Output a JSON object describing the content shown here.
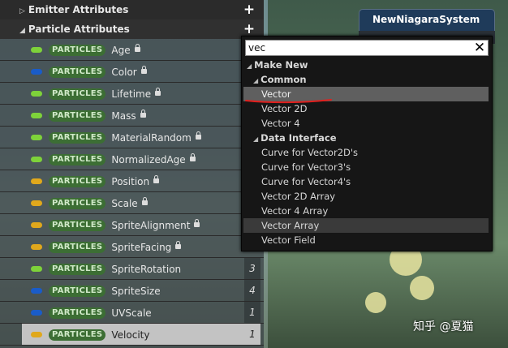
{
  "sections": {
    "emitter": {
      "label": "Emitter Attributes"
    },
    "particle": {
      "label": "Particle Attributes"
    }
  },
  "pill_label": "PARTICLES",
  "attributes": [
    {
      "name": "Age",
      "color": "#7ed23a",
      "count": ""
    },
    {
      "name": "Color",
      "color": "#1a5cc8",
      "count": ""
    },
    {
      "name": "Lifetime",
      "color": "#7ed23a",
      "count": ""
    },
    {
      "name": "Mass",
      "color": "#7ed23a",
      "count": ""
    },
    {
      "name": "MaterialRandom",
      "color": "#7ed23a",
      "count": ""
    },
    {
      "name": "NormalizedAge",
      "color": "#7ed23a",
      "count": ""
    },
    {
      "name": "Position",
      "color": "#e0a81c",
      "count": ""
    },
    {
      "name": "Scale",
      "color": "#e0a81c",
      "count": ""
    },
    {
      "name": "SpriteAlignment",
      "color": "#e0a81c",
      "count": ""
    },
    {
      "name": "SpriteFacing",
      "color": "#e0a81c",
      "count": ""
    },
    {
      "name": "SpriteRotation",
      "color": "#7ed23a",
      "count": "3"
    },
    {
      "name": "SpriteSize",
      "color": "#1a5cc8",
      "count": "4"
    },
    {
      "name": "UVScale",
      "color": "#1a5cc8",
      "count": "1"
    },
    {
      "name": "Velocity",
      "color": "#e0a81c",
      "count": "1",
      "selected": true
    }
  ],
  "node": {
    "title": "NewNiagaraSystem"
  },
  "search": {
    "value": "vec"
  },
  "menu": [
    {
      "label": "Make New",
      "type": "cat"
    },
    {
      "label": "Common",
      "type": "subcat"
    },
    {
      "label": "Vector",
      "type": "item",
      "state": "highlight"
    },
    {
      "label": "Vector 2D",
      "type": "item"
    },
    {
      "label": "Vector 4",
      "type": "item"
    },
    {
      "label": "Data Interface",
      "type": "subcat"
    },
    {
      "label": "Curve for Vector2D's",
      "type": "item"
    },
    {
      "label": "Curve for Vector3's",
      "type": "item"
    },
    {
      "label": "Curve for Vector4's",
      "type": "item"
    },
    {
      "label": "Vector 2D Array",
      "type": "item"
    },
    {
      "label": "Vector 4 Array",
      "type": "item"
    },
    {
      "label": "Vector Array",
      "type": "item",
      "state": "hover"
    },
    {
      "label": "Vector Field",
      "type": "item"
    }
  ],
  "watermark": "知乎 @夏猫",
  "icons": {
    "add": "plus-icon",
    "close": "close-icon",
    "lock": "lock-icon",
    "expand": "triangle-icon"
  },
  "colors": {
    "accent_red": "#e0201e",
    "pill_bg": "#3c6e34",
    "header_bg": "#2b2b2b"
  }
}
